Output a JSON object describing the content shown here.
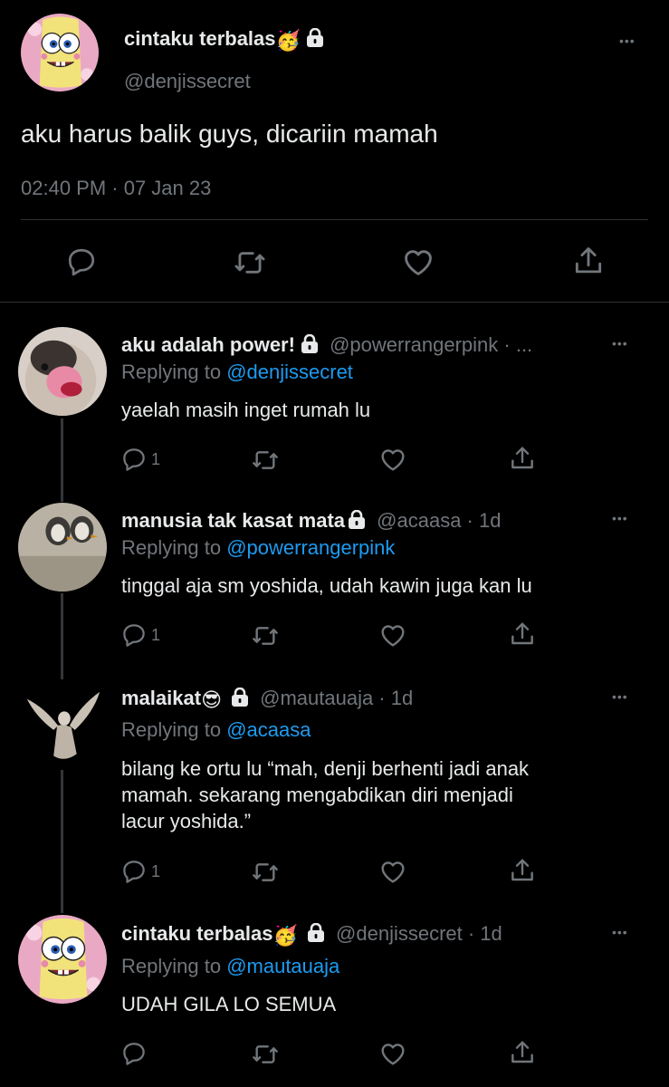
{
  "main_tweet": {
    "display_name": "cintaku terbalas",
    "name_emoji": "🥳",
    "handle": "@denjissecret",
    "text": "aku harus balik guys, dicariin mamah",
    "timestamp": "02:40 PM · 07 Jan 23",
    "more": "•••"
  },
  "replies": [
    {
      "display_name": "aku adalah power!",
      "name_emoji": "",
      "handle_meta": "@powerrangerpink · ...",
      "replying_prefix": "Replying to ",
      "replying_to": "@denjissecret",
      "text": "yaelah masih inget rumah lu",
      "reply_count": "1",
      "more": "•••"
    },
    {
      "display_name": "manusia tak kasat mata",
      "name_emoji": "",
      "handle_meta": "@acaasa · 1d",
      "replying_prefix": "Replying to ",
      "replying_to": "@powerrangerpink",
      "text": "tinggal aja sm yoshida, udah kawin juga kan lu",
      "reply_count": "1",
      "more": "•••"
    },
    {
      "display_name": "malaikat",
      "name_emoji": "😎",
      "handle_meta": "@mautauaja · 1d",
      "replying_prefix": "Replying to ",
      "replying_to": "@acaasa",
      "text_lines": [
        "bilang ke ortu lu “mah, denji berhenti jadi anak",
        "mamah. sekarang mengabdikan diri menjadi",
        "lacur yoshida.”"
      ],
      "reply_count": "1",
      "more": "•••"
    },
    {
      "display_name": "cintaku terbalas",
      "name_emoji": "🥳",
      "handle_meta": "@denjissecret · 1d",
      "replying_prefix": "Replying to ",
      "replying_to": "@mautauaja",
      "text": "UDAH GILA LO SEMUA",
      "reply_count": "",
      "more": "•••"
    }
  ],
  "icons": {
    "reply": "reply-bubble-icon",
    "retweet": "retweet-icon",
    "like": "heart-icon",
    "share": "share-icon",
    "lock": "lock-icon",
    "more": "more-dots-icon"
  },
  "colors": {
    "background": "#000000",
    "text": "#e7e9ea",
    "secondary": "#71767b",
    "link": "#1d9bf0",
    "divider": "#2f3336"
  }
}
